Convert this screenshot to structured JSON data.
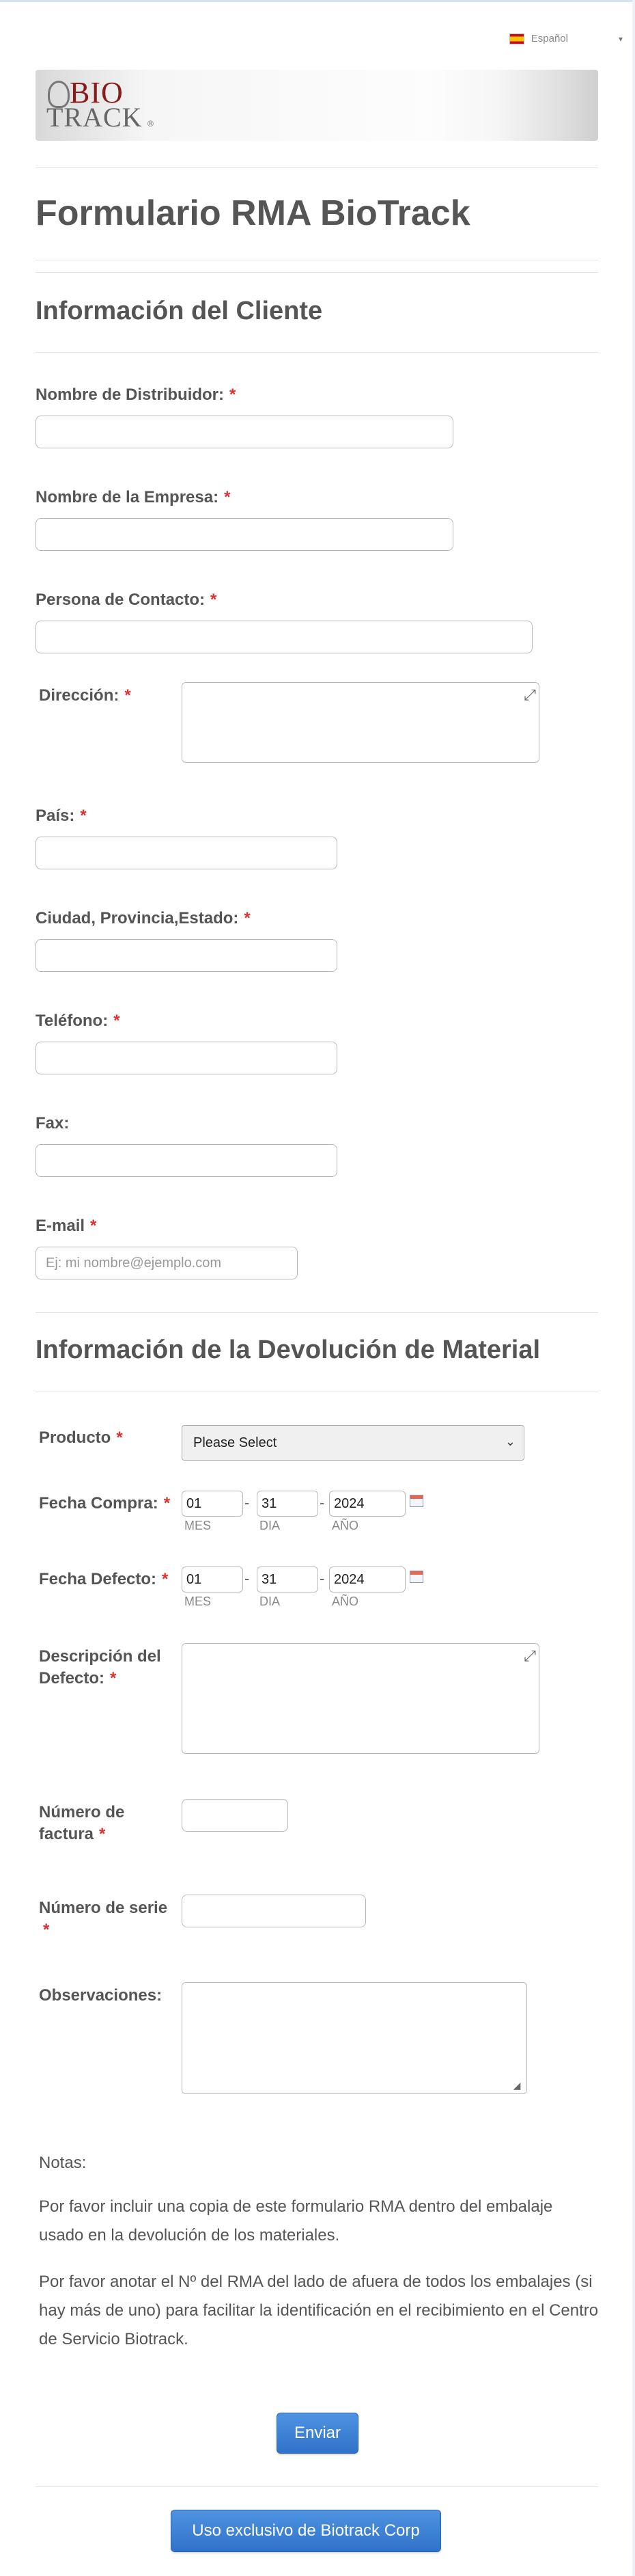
{
  "language": {
    "selected": "Español",
    "flag_icon": "spain-flag-icon"
  },
  "logo": {
    "line1": "BIO",
    "line2": "TRACK",
    "reg": "®"
  },
  "form_title": "Formulario RMA BioTrack",
  "sections": {
    "client": "Información del Cliente",
    "material": "Información de la Devolución de Material"
  },
  "fields": {
    "distribuidor": {
      "label": "Nombre de Distribuidor:",
      "value": ""
    },
    "empresa": {
      "label": "Nombre de la Empresa:",
      "value": ""
    },
    "contacto": {
      "label": "Persona de Contacto:",
      "value": ""
    },
    "direccion": {
      "label": "Dirección:",
      "value": ""
    },
    "pais": {
      "label": "País:",
      "value": ""
    },
    "ciudad": {
      "label": "Ciudad, Provincia,Estado:",
      "value": ""
    },
    "telefono": {
      "label": "Teléfono:",
      "value": ""
    },
    "fax": {
      "label": "Fax:",
      "value": ""
    },
    "email": {
      "label": "E-mail",
      "placeholder": "Ej: mi nombre@ejemplo.com",
      "value": ""
    },
    "producto": {
      "label": "Producto",
      "selected": "Please Select"
    },
    "fecha_compra": {
      "label": "Fecha Compra:",
      "month": "01",
      "day": "31",
      "year": "2024"
    },
    "fecha_defecto": {
      "label": "Fecha Defecto:",
      "month": "01",
      "day": "31",
      "year": "2024"
    },
    "descripcion": {
      "label_line1": "Descripción del",
      "label_line2": "Defecto:",
      "value": ""
    },
    "factura": {
      "label_line1": "Número de",
      "label_line2": "factura",
      "value": ""
    },
    "serie": {
      "label_line1": "Número de serie",
      "value": ""
    },
    "observaciones": {
      "label": "Observaciones:",
      "value": ""
    }
  },
  "date_sublabels": {
    "month": "MES",
    "day": "DIA",
    "year": "AÑO"
  },
  "required_mark": "*",
  "date_separator": "-",
  "notes": {
    "heading": "Notas:",
    "p1": "Por favor incluir una copia de este formulario RMA dentro del embalaje usado en la devolución de los materiales.",
    "p2": "Por favor anotar el Nº del RMA del lado de afuera de todos los embalajes (si hay más de uno) para facilitar la identificación en el recibimiento en el Centro de Servicio Biotrack."
  },
  "buttons": {
    "submit": "Enviar",
    "exclusive": "Uso exclusivo de Biotrack Corp"
  },
  "colors": {
    "accent": "#3a7fd5",
    "required": "#e03030",
    "title": "#555555"
  }
}
